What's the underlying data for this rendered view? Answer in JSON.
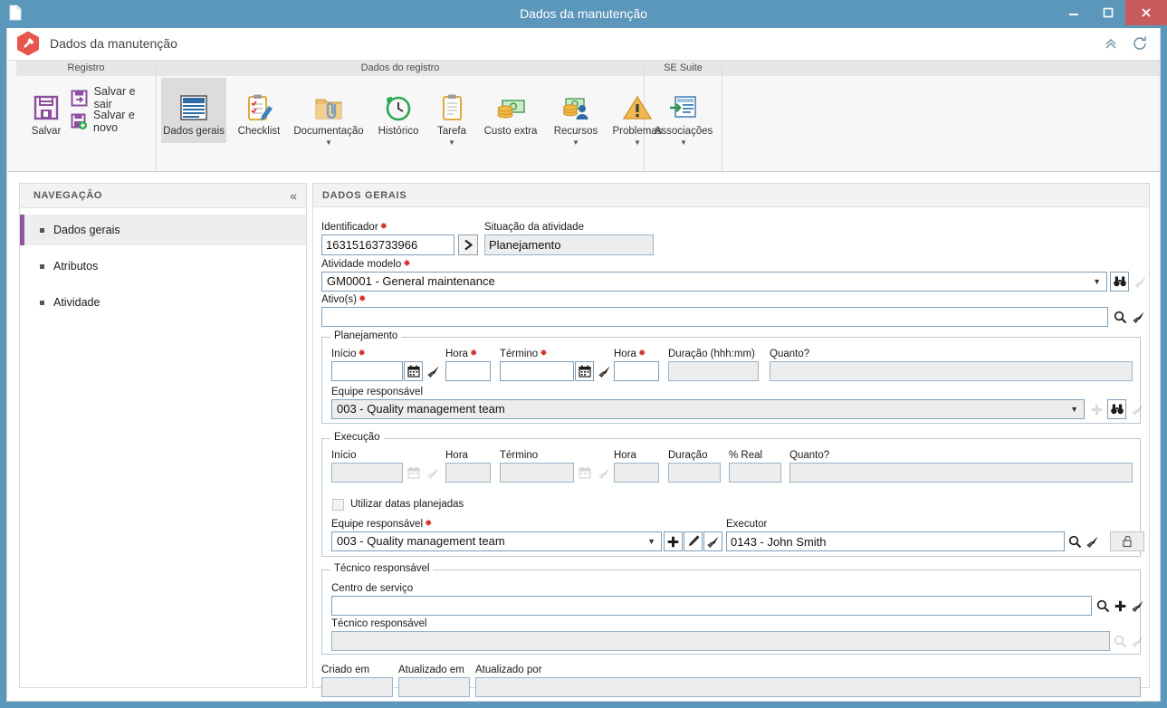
{
  "window": {
    "title": "Dados da manutenção",
    "minimize_label": "–",
    "maximize_label": "❐",
    "close_label": "✕",
    "doc_icon": "document-icon"
  },
  "app": {
    "title": "Dados da manutenção",
    "logo_icon": "maintenance-hammer-icon",
    "collapse_icon": "chevron-double-up-icon",
    "refresh_icon": "refresh-icon"
  },
  "ribbon": {
    "groups": [
      {
        "title": "Registro"
      },
      {
        "title": "Dados do registro"
      },
      {
        "title": "SE Suite"
      }
    ],
    "registro": {
      "save": "Salvar",
      "save_and_exit": "Salvar e sair",
      "save_and_new": "Salvar e novo"
    },
    "dados_registro": [
      {
        "label": "Dados gerais",
        "icon": "general-data-icon",
        "caret": false,
        "active": true
      },
      {
        "label": "Checklist",
        "icon": "checklist-icon",
        "caret": false,
        "active": false
      },
      {
        "label": "Documentação",
        "icon": "documentation-folder-icon",
        "caret": true,
        "active": false
      },
      {
        "label": "Histórico",
        "icon": "history-clock-icon",
        "caret": false,
        "active": false
      },
      {
        "label": "Tarefa",
        "icon": "task-clipboard-icon",
        "caret": true,
        "active": false
      },
      {
        "label": "Custo extra",
        "icon": "extra-cost-money-icon",
        "caret": false,
        "active": false
      },
      {
        "label": "Recursos",
        "icon": "resources-money-person-icon",
        "caret": true,
        "active": false
      },
      {
        "label": "Problemas",
        "icon": "warning-triangle-icon",
        "caret": true,
        "active": false
      }
    ],
    "se_suite": [
      {
        "label": "Associações",
        "icon": "associations-icon",
        "caret": true
      }
    ]
  },
  "nav": {
    "title": "NAVEGAÇÃO",
    "collapse_icon": "chevron-double-left-icon",
    "items": [
      {
        "label": "Dados gerais",
        "active": true
      },
      {
        "label": "Atributos",
        "active": false
      },
      {
        "label": "Atividade",
        "active": false
      }
    ]
  },
  "form": {
    "section_title": "DADOS GERAIS",
    "identificador": {
      "label": "Identificador",
      "required": true,
      "value": "16315163733966",
      "go_icon": "chevron-right-icon"
    },
    "situacao": {
      "label": "Situação da atividade",
      "required": false,
      "value": "Planejamento"
    },
    "atividade_modelo": {
      "label": "Atividade modelo",
      "required": true,
      "value": "GM0001 - General maintenance",
      "search_icon": "binoculars-icon",
      "clear_icon": "brush-icon"
    },
    "ativos": {
      "label": "Ativo(s)",
      "required": true,
      "value": "",
      "search_icon": "magnifier-icon",
      "clear_icon": "brush-icon"
    },
    "planejamento": {
      "legend": "Planejamento",
      "inicio": {
        "label": "Início",
        "required": true,
        "value": "",
        "calendar_icon": "calendar-icon",
        "clear_icon": "brush-icon"
      },
      "hora_inicio": {
        "label": "Hora",
        "required": true,
        "value": ""
      },
      "termino": {
        "label": "Término",
        "required": true,
        "value": "",
        "calendar_icon": "calendar-icon",
        "clear_icon": "brush-icon"
      },
      "hora_termino": {
        "label": "Hora",
        "required": true,
        "value": ""
      },
      "duracao": {
        "label": "Duração (hhh:mm)",
        "required": false,
        "value": ""
      },
      "quanto": {
        "label": "Quanto?",
        "required": false,
        "value": ""
      },
      "equipe": {
        "label": "Equipe responsável",
        "required": false,
        "value": "003 - Quality management team",
        "add_icon": "plus-icon",
        "search_icon": "binoculars-icon",
        "clear_icon": "brush-icon"
      }
    },
    "execucao": {
      "legend": "Execução",
      "inicio": {
        "label": "Início",
        "required": false,
        "value": "",
        "calendar_icon": "calendar-icon",
        "clear_icon": "brush-icon"
      },
      "hora_inicio": {
        "label": "Hora",
        "required": false,
        "value": ""
      },
      "termino": {
        "label": "Término",
        "required": false,
        "value": "",
        "calendar_icon": "calendar-icon",
        "clear_icon": "brush-icon"
      },
      "hora_termino": {
        "label": "Hora",
        "required": false,
        "value": ""
      },
      "duracao": {
        "label": "Duração",
        "required": false,
        "value": ""
      },
      "percent_real": {
        "label": "% Real",
        "required": false,
        "value": ""
      },
      "quanto": {
        "label": "Quanto?",
        "required": false,
        "value": ""
      },
      "usar_datas": {
        "label": "Utilizar datas planejadas",
        "checked": false
      },
      "equipe": {
        "label": "Equipe responsável",
        "required": true,
        "value": "003 - Quality management team",
        "add_icon": "plus-icon",
        "edit_icon": "pencil-icon",
        "clear_icon": "brush-icon"
      },
      "executor": {
        "label": "Executor",
        "required": false,
        "value": "0143 - John Smith",
        "search_icon": "magnifier-icon",
        "clear_icon": "brush-icon",
        "lock_icon": "unlock-icon"
      }
    },
    "tecnico": {
      "legend": "Técnico responsável",
      "centro_servico": {
        "label": "Centro de serviço",
        "required": false,
        "value": "",
        "search_icon": "magnifier-icon",
        "add_icon": "plus-icon",
        "clear_icon": "brush-icon"
      },
      "tecnico_responsavel": {
        "label": "Técnico responsável",
        "required": false,
        "value": "",
        "search_icon": "magnifier-icon",
        "clear_icon": "brush-icon"
      }
    },
    "footer": {
      "criado_em": {
        "label": "Criado em",
        "value": ""
      },
      "atualizado_em": {
        "label": "Atualizado em",
        "value": ""
      },
      "atualizado_por": {
        "label": "Atualizado por",
        "value": ""
      }
    }
  },
  "colors": {
    "titlebar": "#5b96bb",
    "close_button": "#c75b5b",
    "nav_accent": "#9055a2",
    "save_purple": "#8d4f9e",
    "input_border": "#7f9db9",
    "readonly_bg": "#ededed"
  }
}
